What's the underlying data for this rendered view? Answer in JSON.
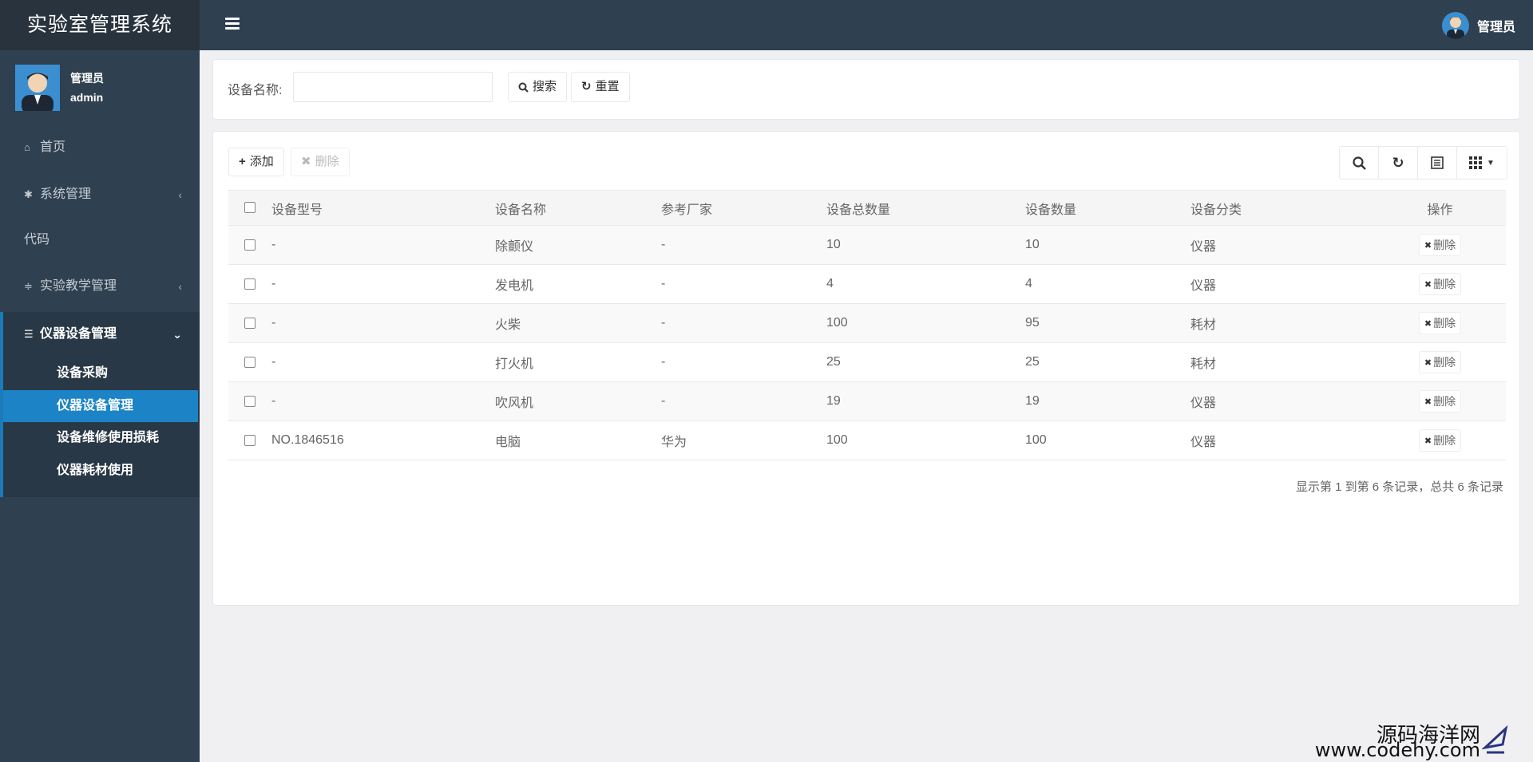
{
  "app": {
    "title": "实验室管理系统"
  },
  "header": {
    "user_name": "管理员"
  },
  "profile": {
    "name": "管理员",
    "id": "admin"
  },
  "sidebar": {
    "items": [
      {
        "label": "首页",
        "icon": "home-icon"
      },
      {
        "label": "系统管理",
        "icon": "gear-icon",
        "arrow": "‹"
      },
      {
        "label": "代码",
        "icon": ""
      },
      {
        "label": "实验教学管理",
        "icon": "sliders-icon",
        "arrow": "‹"
      },
      {
        "label": "仪器设备管理",
        "icon": "server-icon",
        "arrow": "⌄"
      }
    ],
    "sub_items": [
      {
        "label": "设备采购"
      },
      {
        "label": "仪器设备管理",
        "active": true
      },
      {
        "label": "设备维修使用损耗"
      },
      {
        "label": "仪器耗材使用"
      }
    ]
  },
  "search": {
    "label": "设备名称:",
    "value": "",
    "search_btn": "搜索",
    "reset_btn": "重置"
  },
  "toolbar": {
    "add_label": "添加",
    "delete_label": "删除"
  },
  "table": {
    "columns": [
      "设备型号",
      "设备名称",
      "参考厂家",
      "设备总数量",
      "设备数量",
      "设备分类",
      "操作"
    ],
    "rows": [
      {
        "model": "-",
        "name": "除颤仪",
        "maker": "-",
        "total": "10",
        "count": "10",
        "category": "仪器",
        "action": "删除"
      },
      {
        "model": "-",
        "name": "发电机",
        "maker": "-",
        "total": "4",
        "count": "4",
        "category": "仪器",
        "action": "删除"
      },
      {
        "model": "-",
        "name": "火柴",
        "maker": "-",
        "total": "100",
        "count": "95",
        "category": "耗材",
        "action": "删除"
      },
      {
        "model": "-",
        "name": "打火机",
        "maker": "-",
        "total": "25",
        "count": "25",
        "category": "耗材",
        "action": "删除"
      },
      {
        "model": "-",
        "name": "吹风机",
        "maker": "-",
        "total": "19",
        "count": "19",
        "category": "仪器",
        "action": "删除"
      },
      {
        "model": "NO.1846516",
        "name": "电脑",
        "maker": "华为",
        "total": "100",
        "count": "100",
        "category": "仪器",
        "action": "删除"
      }
    ]
  },
  "pager": {
    "info": "显示第 1 到第 6 条记录，总共 6 条记录"
  },
  "watermark": {
    "cn": "源码海洋网",
    "url": "www.codehy.com"
  },
  "colors": {
    "topbar": "#2f4050",
    "sidebar": "#2f4050",
    "active": "#1c84c6"
  }
}
